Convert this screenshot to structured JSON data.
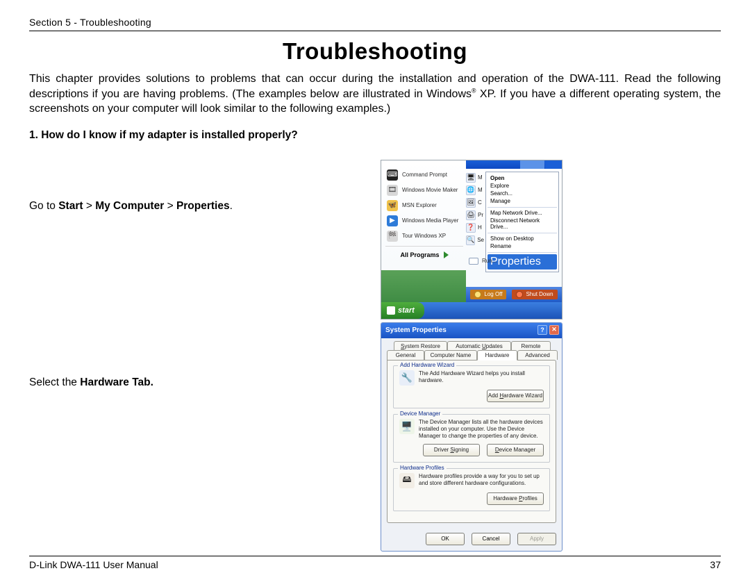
{
  "header": "Section 5 - Troubleshooting",
  "title": "Troubleshooting",
  "intro_html": "This chapter provides solutions to problems that can occur during the installation and operation of the DWA-111.  Read the following descriptions if you are having problems.  (The examples below are illustrated in Windows<sup>®</sup> XP.  If you have a different operating system, the screenshots on your computer will look similar to the following examples.)",
  "q1": "1.  How do I know if my adapter is installed properly?",
  "step1_html": "Go to <b>Start</b> > <b>My Computer</b> > <b>Properties</b>.",
  "step2_html": "Select the <b>Hardware Tab.</b>",
  "start_menu": {
    "left": [
      {
        "label": "Command Prompt",
        "ico": "⌨",
        "bg": "#222",
        "fg": "#fff"
      },
      {
        "label": "Windows Movie Maker",
        "ico": "🎞",
        "bg": "#d8d8d8",
        "fg": "#444"
      },
      {
        "label": "MSN Explorer",
        "ico": "🦋",
        "bg": "#f0c24a",
        "fg": "#b05a00"
      },
      {
        "label": "Windows Media Player",
        "ico": "▶",
        "bg": "#2d7bd8",
        "fg": "#fff"
      },
      {
        "label": "Tour Windows XP",
        "ico": "🏁",
        "bg": "#d8d8d8",
        "fg": "#444"
      }
    ],
    "all_programs": "All Programs",
    "right_top": [
      {
        "label": "Open",
        "bold": true
      },
      {
        "label": "Explore",
        "bold": false
      },
      {
        "label": "Search...",
        "bold": false
      },
      {
        "label": "Manage",
        "bold": false
      }
    ],
    "right_mid": [
      {
        "label": "Map Network Drive..."
      },
      {
        "label": "Disconnect Network Drive..."
      }
    ],
    "right_bot": [
      {
        "label": "Show on Desktop"
      },
      {
        "label": "Rename"
      }
    ],
    "selected": "Properties",
    "run": "Run...",
    "logoff": "Log Off",
    "shutdown": "Shut Down",
    "start": "start",
    "side_icons": [
      {
        "glyph": "🖥",
        "label": "M"
      },
      {
        "glyph": "🌐",
        "label": "M"
      },
      {
        "glyph": "🖼",
        "label": "C"
      },
      {
        "glyph": "🖨",
        "label": "Pr"
      },
      {
        "glyph": "❓",
        "label": "H"
      },
      {
        "glyph": "🔍",
        "label": "Se"
      }
    ]
  },
  "dialog": {
    "title": "System Properties",
    "tabs_row1": [
      "System Restore",
      "Automatic Updates",
      "Remote"
    ],
    "tabs_row2": [
      "General",
      "Computer Name",
      "Hardware",
      "Advanced"
    ],
    "active_tab": "Hardware",
    "group1": {
      "title": "Add Hardware Wizard",
      "text": "The Add Hardware Wizard helps you install hardware.",
      "button": "Add Hardware Wizard"
    },
    "group2": {
      "title": "Device Manager",
      "text": "The Device Manager lists all the hardware devices installed on your computer. Use the Device Manager to change the properties of any device.",
      "btn1": "Driver Signing",
      "btn2": "Device Manager"
    },
    "group3": {
      "title": "Hardware Profiles",
      "text": "Hardware profiles provide a way for you to set up and store different hardware configurations.",
      "button": "Hardware Profiles"
    },
    "footer": {
      "ok": "OK",
      "cancel": "Cancel",
      "apply": "Apply"
    }
  },
  "footer": {
    "left": "D-Link DWA-111 User Manual",
    "right": "37"
  }
}
